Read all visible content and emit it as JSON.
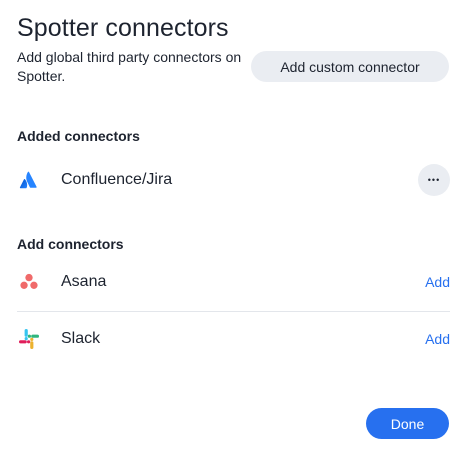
{
  "dialog": {
    "title": "Spotter connectors",
    "subtitle": "Add global third party connectors on Spotter.",
    "add_custom_label": "Add custom connector",
    "done_label": "Done"
  },
  "added_section": {
    "header": "Added connectors",
    "items": [
      {
        "label": "Confluence/Jira",
        "icon": "atlassian-icon",
        "action": "more-options",
        "action_glyph": "•••"
      }
    ]
  },
  "available_section": {
    "header": "Add connectors",
    "items": [
      {
        "label": "Asana",
        "icon": "asana-icon",
        "action_label": "Add"
      },
      {
        "label": "Slack",
        "icon": "slack-icon",
        "action_label": "Add"
      }
    ]
  },
  "colors": {
    "primary": "#2770ef",
    "button_secondary_bg": "#eaedf2",
    "text": "#1d232f",
    "divider": "#e3e6eb",
    "atlassian_blue": "#2684ff",
    "asana_coral": "#f06a6a",
    "slack_red": "#e01e5a",
    "slack_blue": "#36c5f0",
    "slack_green": "#2eb67d",
    "slack_yellow": "#ecb22e"
  }
}
